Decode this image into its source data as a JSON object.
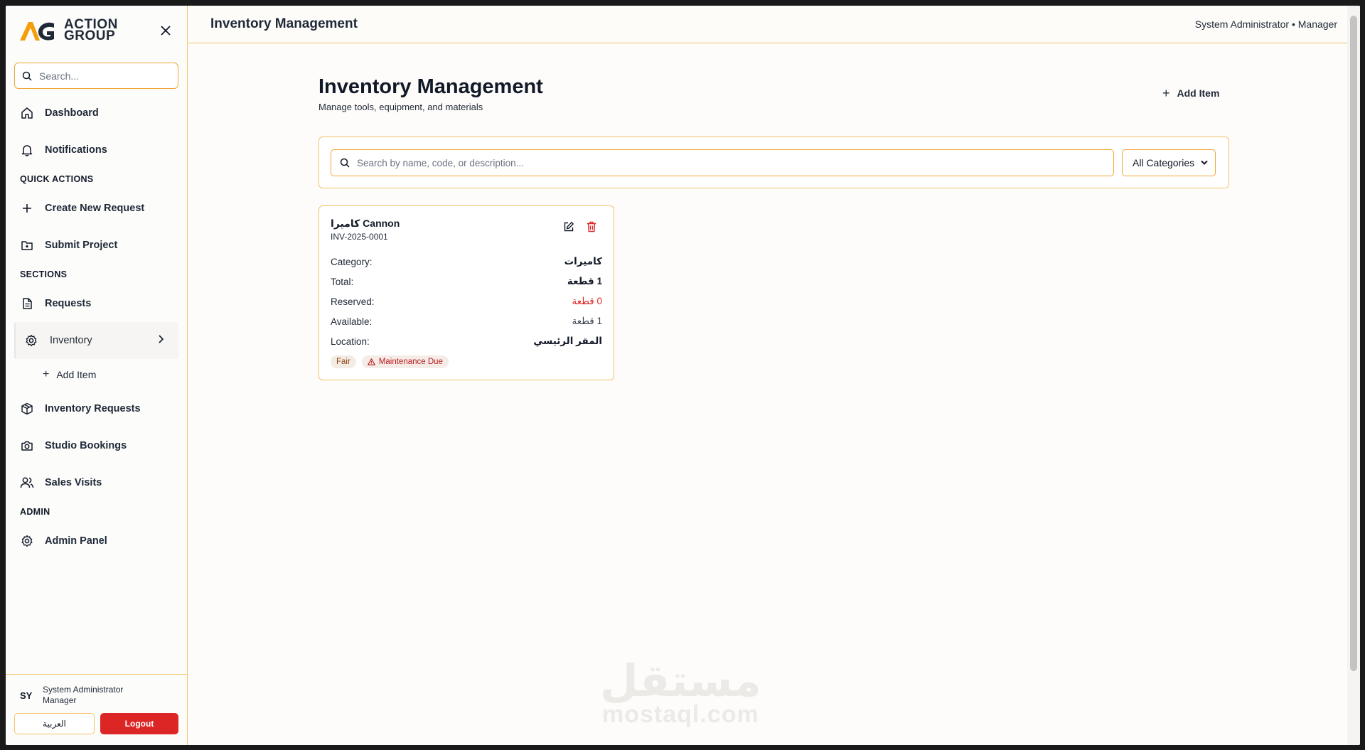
{
  "brand": {
    "line1": "ACTION",
    "line2": "GROUP"
  },
  "sidebar": {
    "search_placeholder": "Search...",
    "items_top": [
      {
        "label": "Dashboard"
      },
      {
        "label": "Notifications"
      }
    ],
    "quick_actions_label": "QUICK ACTIONS",
    "quick_actions": [
      {
        "label": "Create New Request"
      },
      {
        "label": "Submit Project"
      }
    ],
    "sections_label": "SECTIONS",
    "sections": [
      {
        "label": "Requests"
      },
      {
        "label": "Inventory"
      },
      {
        "label": "Inventory Requests"
      },
      {
        "label": "Studio Bookings"
      },
      {
        "label": "Sales Visits"
      }
    ],
    "inventory_sub": {
      "label": "Add Item"
    },
    "admin_label": "ADMIN",
    "admin": [
      {
        "label": "Admin Panel"
      }
    ],
    "footer": {
      "avatar": "SY",
      "user_name": "System Administrator",
      "user_role": "Manager",
      "lang_button": "العربية",
      "logout_button": "Logout"
    }
  },
  "topbar": {
    "title": "Inventory Management",
    "user": "System Administrator • Manager"
  },
  "page": {
    "title": "Inventory Management",
    "subtitle": "Manage tools, equipment, and materials",
    "add_button": "Add Item",
    "search_placeholder": "Search by name, code, or description...",
    "category_select": "All Categories"
  },
  "items": [
    {
      "name": "كاميرا Cannon",
      "code": "INV-2025-0001",
      "fields": [
        {
          "label": "Category:",
          "value": "كاميرات"
        },
        {
          "label": "Total:",
          "value": "1 قطعة"
        },
        {
          "label": "Reserved:",
          "value": "0 قطعة"
        },
        {
          "label": "Available:",
          "value": "1 قطعة"
        },
        {
          "label": "Location:",
          "value": "المقر الرئيسي"
        }
      ],
      "badges": [
        {
          "label": "Fair"
        },
        {
          "label": "Maintenance Due"
        }
      ]
    }
  ],
  "watermark": {
    "ar": "مستقل",
    "en": "mostaql.com"
  },
  "colors": {
    "accent": "#f4a533",
    "danger": "#dc2626",
    "border": "#f4c46a"
  }
}
